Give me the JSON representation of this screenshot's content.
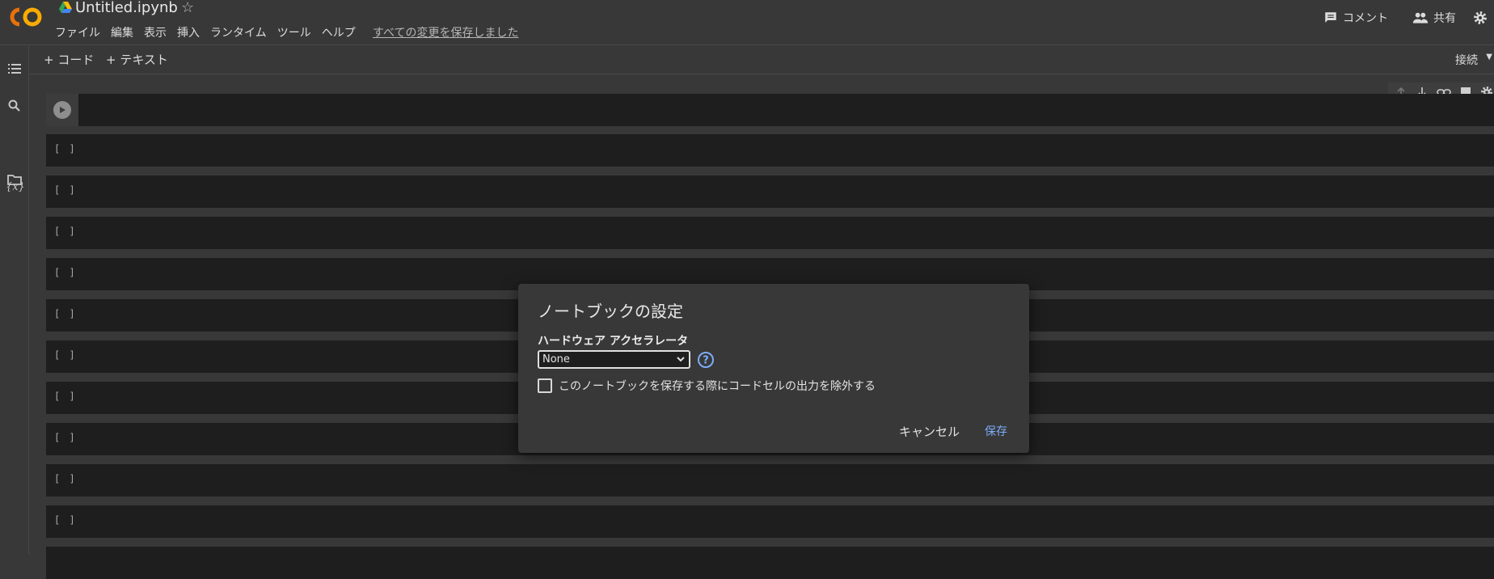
{
  "app": {
    "title": "Untitled.ipynb",
    "save_status": "すべての変更を保存しました",
    "brand_color": "#f9ab00"
  },
  "menu": {
    "items": [
      "ファイル",
      "編集",
      "表示",
      "挿入",
      "ランタイム",
      "ツール",
      "ヘルプ"
    ]
  },
  "header_right": {
    "comment_label": "コメント",
    "share_label": "共有"
  },
  "rail": {
    "variables_label": "{x}"
  },
  "toolbar": {
    "add_code_label": "+ コード",
    "add_text_label": "+ テキスト",
    "connect_label": "接続"
  },
  "cells": {
    "empty_label": "[ ]",
    "count": 10
  },
  "dialog": {
    "title": "ノートブックの設定",
    "accelerator_label": "ハードウェア アクセラレータ",
    "accelerator_value": "None",
    "omit_output_label": "このノートブックを保存する際にコードセルの出力を除外する",
    "omit_output_checked": false,
    "cancel_label": "キャンセル",
    "save_label": "保存"
  }
}
